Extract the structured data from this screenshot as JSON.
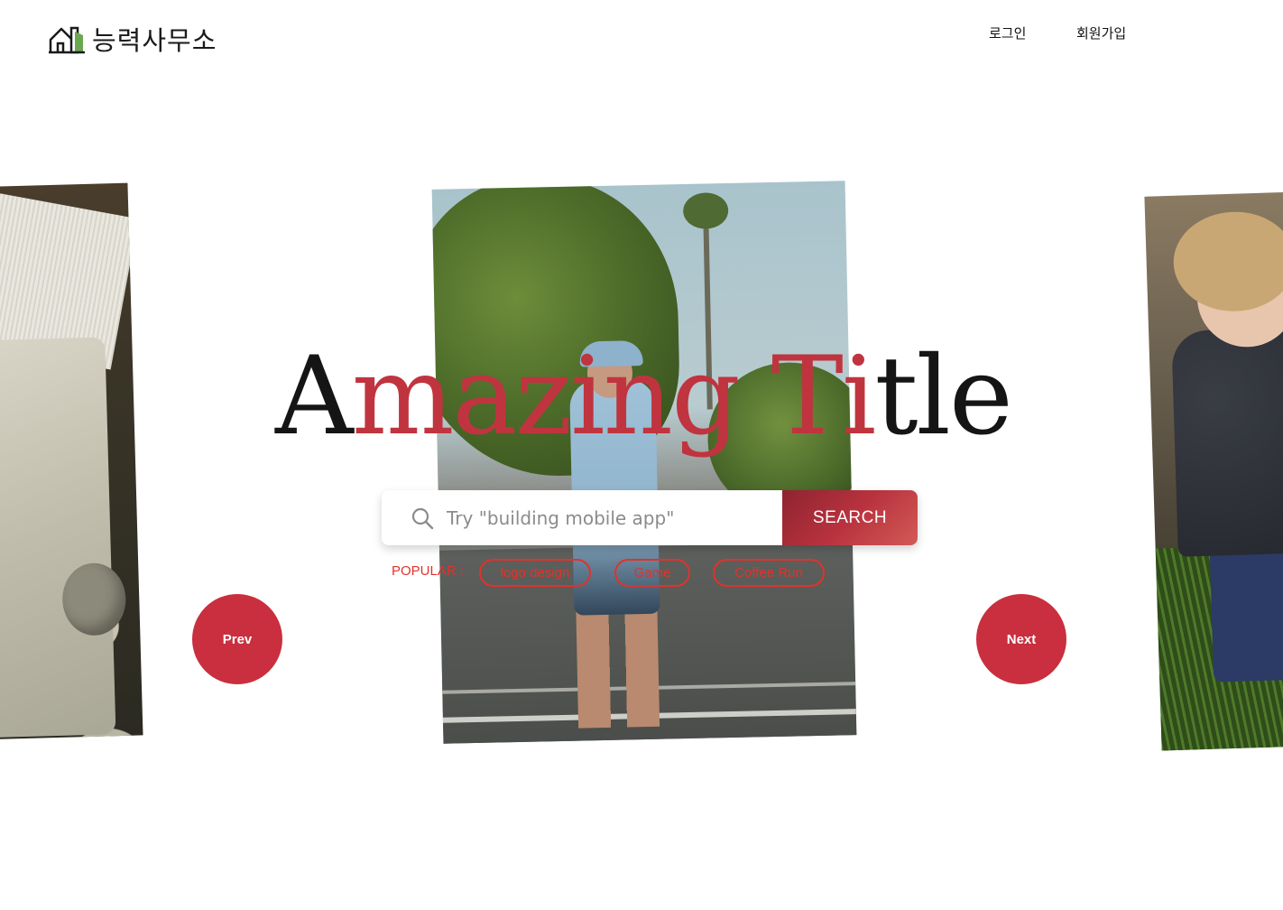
{
  "header": {
    "logo_text": "능력사무소",
    "nav": {
      "login": "로그인",
      "signup": "회원가입"
    }
  },
  "hero": {
    "title_dark_1": "A",
    "title_red": "mazing Ti",
    "title_dark_2": "tle",
    "colors": {
      "accent": "#c92f3e",
      "popular": "#e2322b",
      "text": "#151515"
    }
  },
  "search": {
    "placeholder": "Try \"building mobile app\"",
    "button_label": "SEARCH",
    "icon": "search-icon"
  },
  "popular": {
    "label": "POPULAR :",
    "tags": [
      "logo design",
      "Game",
      "Coffee Run"
    ]
  },
  "carousel": {
    "prev_label": "Prev",
    "next_label": "Next"
  }
}
